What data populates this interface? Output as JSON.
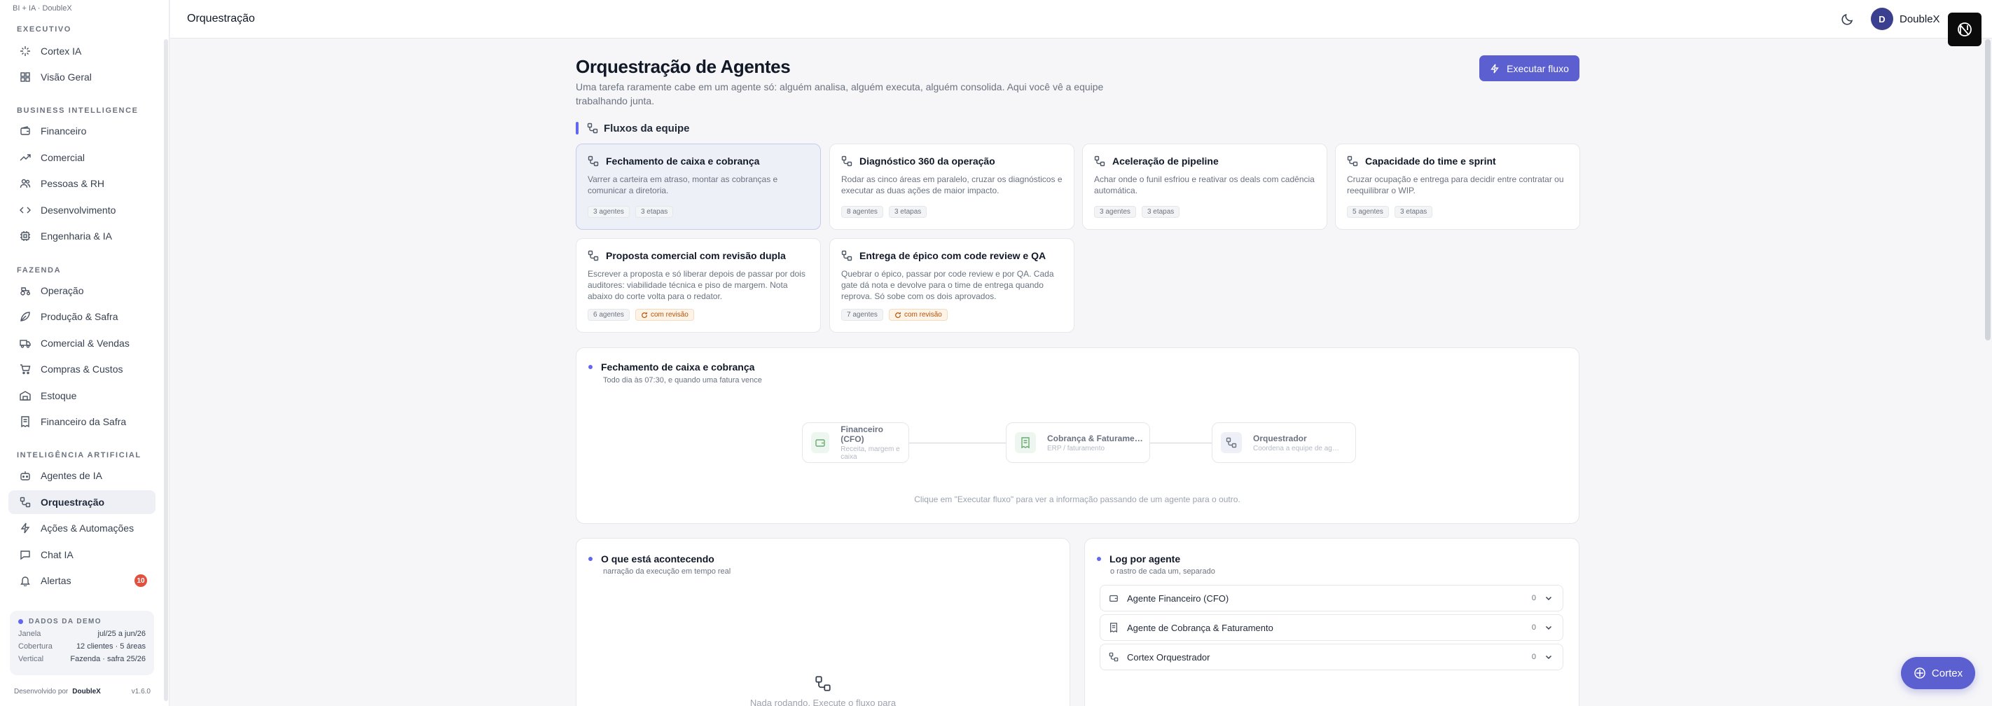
{
  "brand": "BI + IA · DoubleX",
  "sidebar": {
    "sections": [
      {
        "label": "EXECUTIVO",
        "items": [
          {
            "label": "Cortex IA",
            "icon": "sparkle-icon"
          },
          {
            "label": "Visão Geral",
            "icon": "grid-icon"
          }
        ]
      },
      {
        "label": "BUSINESS INTELLIGENCE",
        "items": [
          {
            "label": "Financeiro",
            "icon": "wallet-icon"
          },
          {
            "label": "Comercial",
            "icon": "trending-up-icon"
          },
          {
            "label": "Pessoas & RH",
            "icon": "users-icon"
          },
          {
            "label": "Desenvolvimento",
            "icon": "code-icon"
          },
          {
            "label": "Engenharia & IA",
            "icon": "cpu-icon"
          }
        ]
      },
      {
        "label": "FAZENDA",
        "items": [
          {
            "label": "Operação",
            "icon": "tractor-icon"
          },
          {
            "label": "Produção & Safra",
            "icon": "leaf-icon"
          },
          {
            "label": "Comercial & Vendas",
            "icon": "truck-icon"
          },
          {
            "label": "Compras & Custos",
            "icon": "cart-icon"
          },
          {
            "label": "Estoque",
            "icon": "warehouse-icon"
          },
          {
            "label": "Financeiro da Safra",
            "icon": "receipt-icon"
          }
        ]
      },
      {
        "label": "INTELIGÊNCIA ARTIFICIAL",
        "items": [
          {
            "label": "Agentes de IA",
            "icon": "bot-icon"
          },
          {
            "label": "Orquestração",
            "icon": "workflow-icon"
          },
          {
            "label": "Ações & Automações",
            "icon": "zap-icon"
          },
          {
            "label": "Chat IA",
            "icon": "chat-icon"
          },
          {
            "label": "Alertas",
            "icon": "bell-icon",
            "badge": "10"
          }
        ]
      }
    ],
    "demo": {
      "title": "DADOS DA DEMO",
      "rows": [
        {
          "k": "Janela",
          "v": "jul/25 a jun/26"
        },
        {
          "k": "Cobertura",
          "v": "12 clientes · 5 áreas"
        },
        {
          "k": "Vertical",
          "v": "Fazenda · safra 25/26"
        }
      ]
    },
    "footer": {
      "dev_label": "Desenvolvido por",
      "dev_name": "DoubleX",
      "version": "v1.6.0"
    }
  },
  "topbar": {
    "title": "Orquestração",
    "avatar_initial": "D",
    "user_name": "DoubleX"
  },
  "main": {
    "title": "Orquestração de Agentes",
    "subtitle": "Uma tarefa raramente cabe em um agente só: alguém analisa, alguém executa, alguém consolida. Aqui você vê a equipe trabalhando junta.",
    "run_button": "Executar fluxo",
    "flows_heading": "Fluxos da equipe",
    "flows": [
      {
        "title": "Fechamento de caixa e cobrança",
        "desc": "Varrer a carteira em atraso, montar as cobranças e comunicar a diretoria.",
        "chips": [
          "3 agentes",
          "3 etapas"
        ]
      },
      {
        "title": "Diagnóstico 360 da operação",
        "desc": "Rodar as cinco áreas em paralelo, cruzar os diagnósticos e executar as duas ações de maior impacto.",
        "chips": [
          "8 agentes",
          "3 etapas"
        ]
      },
      {
        "title": "Aceleração de pipeline",
        "desc": "Achar onde o funil esfriou e reativar os deals com cadência automática.",
        "chips": [
          "3 agentes",
          "3 etapas"
        ]
      },
      {
        "title": "Capacidade do time e sprint",
        "desc": "Cruzar ocupação e entrega para decidir entre contratar ou reequilibrar o WIP.",
        "chips": [
          "5 agentes",
          "3 etapas"
        ]
      },
      {
        "title": "Proposta comercial com revisão dupla",
        "desc": "Escrever a proposta e só liberar depois de passar por dois auditores: viabilidade técnica e piso de margem. Nota abaixo do corte volta para o redator.",
        "chips": [
          "6 agentes"
        ],
        "review": "com revisão"
      },
      {
        "title": "Entrega de épico com code review e QA",
        "desc": "Quebrar o épico, passar por code review e por QA. Cada gate dá nota e devolve para o time de entrega quando reprova. Só sobe com os dois aprovados.",
        "chips": [
          "7 agentes"
        ],
        "review": "com revisão"
      }
    ],
    "selected_flow": {
      "title": "Fechamento de caixa e cobrança",
      "subtitle": "Todo dia às 07:30, e quando uma fatura vence",
      "nodes": [
        {
          "title": "Financeiro (CFO)",
          "sub": "Receita, margem e caixa"
        },
        {
          "title": "Cobrança & Faturame…",
          "sub": "ERP / faturamento"
        },
        {
          "title": "Orquestrador",
          "sub": "Coordena a equipe de ag…"
        }
      ],
      "hint": "Clique em \"Executar fluxo\" para ver a informação passando de um agente para o outro."
    },
    "activity": {
      "title": "O que está acontecendo",
      "subtitle": "narração da execução em tempo real",
      "empty_text": "Nada rodando. Execute o fluxo para"
    },
    "log": {
      "title": "Log por agente",
      "subtitle": "o rastro de cada um, separado",
      "rows": [
        {
          "label": "Agente Financeiro (CFO)",
          "count": "0"
        },
        {
          "label": "Agente de Cobrança & Faturamento",
          "count": "0"
        },
        {
          "label": "Cortex Orquestrador",
          "count": "0"
        }
      ]
    }
  },
  "fab": {
    "label": "Cortex"
  },
  "colors": {
    "accent": "#5b5fcf",
    "badge": "#e0523f",
    "review": "#b45309"
  }
}
